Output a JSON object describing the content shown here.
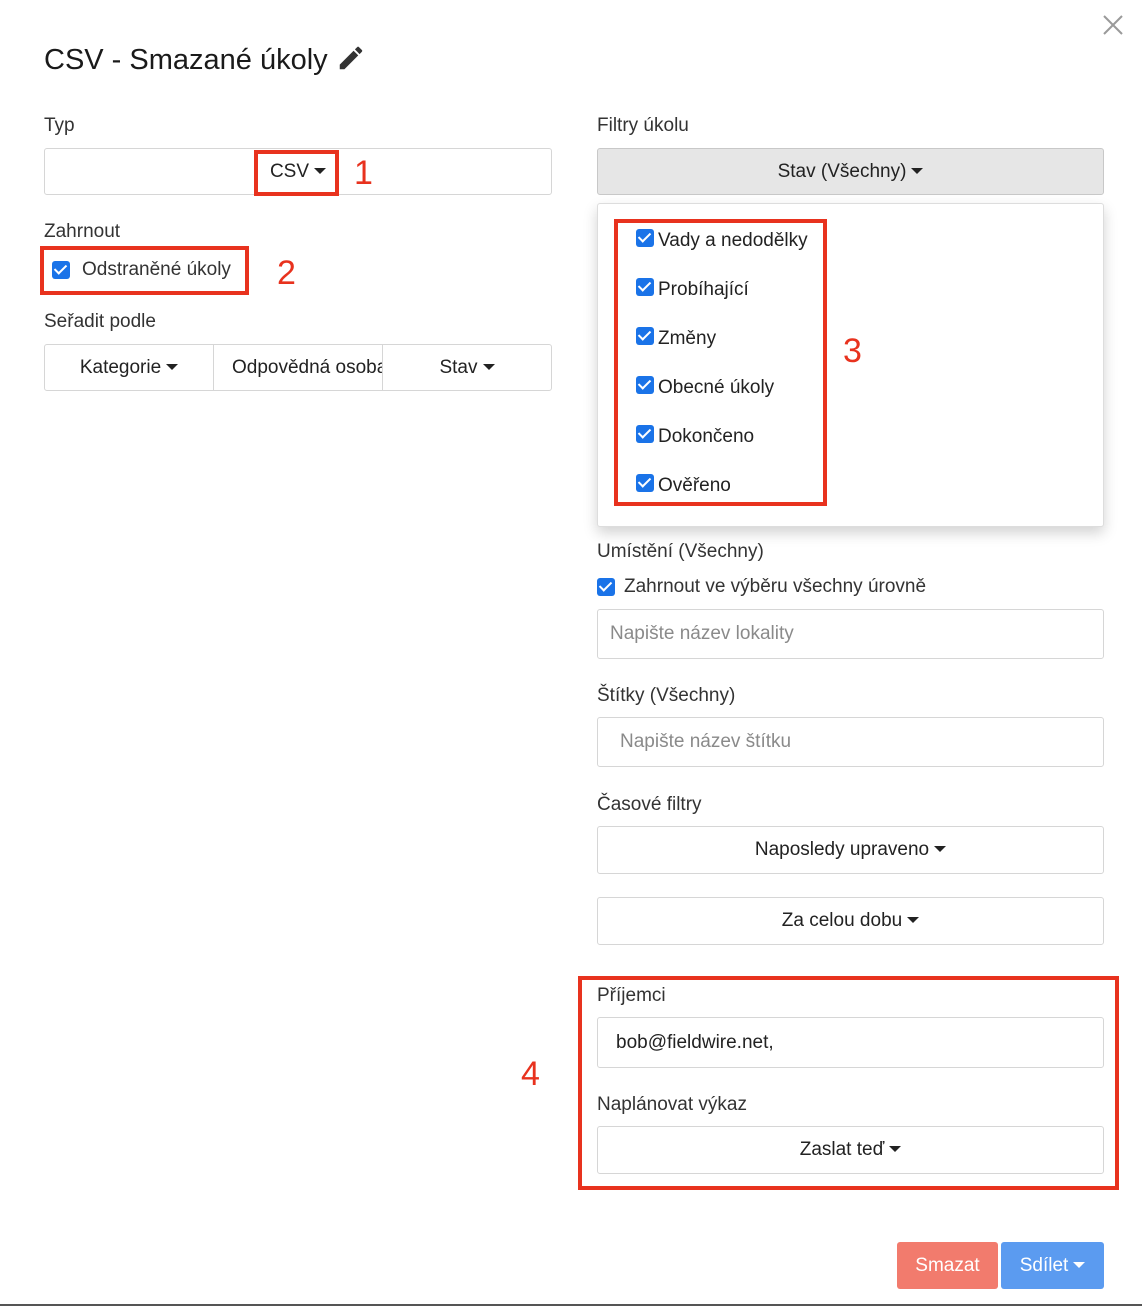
{
  "dialog": {
    "title": "CSV - Smazané úkoly"
  },
  "left": {
    "type_label": "Typ",
    "type_value": "CSV",
    "include_label": "Zahrnout",
    "include_option": "Odstraněné úkoly",
    "sort_label": "Seřadit podle",
    "sort_buttons": [
      "Kategorie",
      "Odpovědná osoba",
      "Stav"
    ]
  },
  "right": {
    "filters_label": "Filtry úkolu",
    "status_button": "Stav (Všechny)",
    "status_options": [
      "Vady a nedodělky",
      "Probíhající",
      "Změny",
      "Obecné úkoly",
      "Dokončeno",
      "Ověřeno"
    ],
    "location_label": "Umístění (Všechny)",
    "location_checkbox": "Zahrnout ve výběru všechny úrovně",
    "location_placeholder": "Napište název lokality",
    "tags_label": "Štítky (Všechny)",
    "tags_placeholder": "Napište název štítku",
    "time_label": "Časové filtry",
    "time_modified": "Naposledy upraveno",
    "time_range": "Za celou dobu",
    "recipients_label": "Příjemci",
    "recipients_value": "bob@fieldwire.net,",
    "schedule_label": "Naplánovat výkaz",
    "schedule_value": "Zaslat teď"
  },
  "footer": {
    "delete_label": "Smazat",
    "share_label": "Sdílet"
  },
  "annotations": {
    "n1": "1",
    "n2": "2",
    "n3": "3",
    "n4": "4"
  },
  "colors": {
    "checkbox": "#1a73e8",
    "annotation_red": "#e8321e",
    "delete_button": "#f27b6d",
    "share_button": "#5b9bf0"
  }
}
